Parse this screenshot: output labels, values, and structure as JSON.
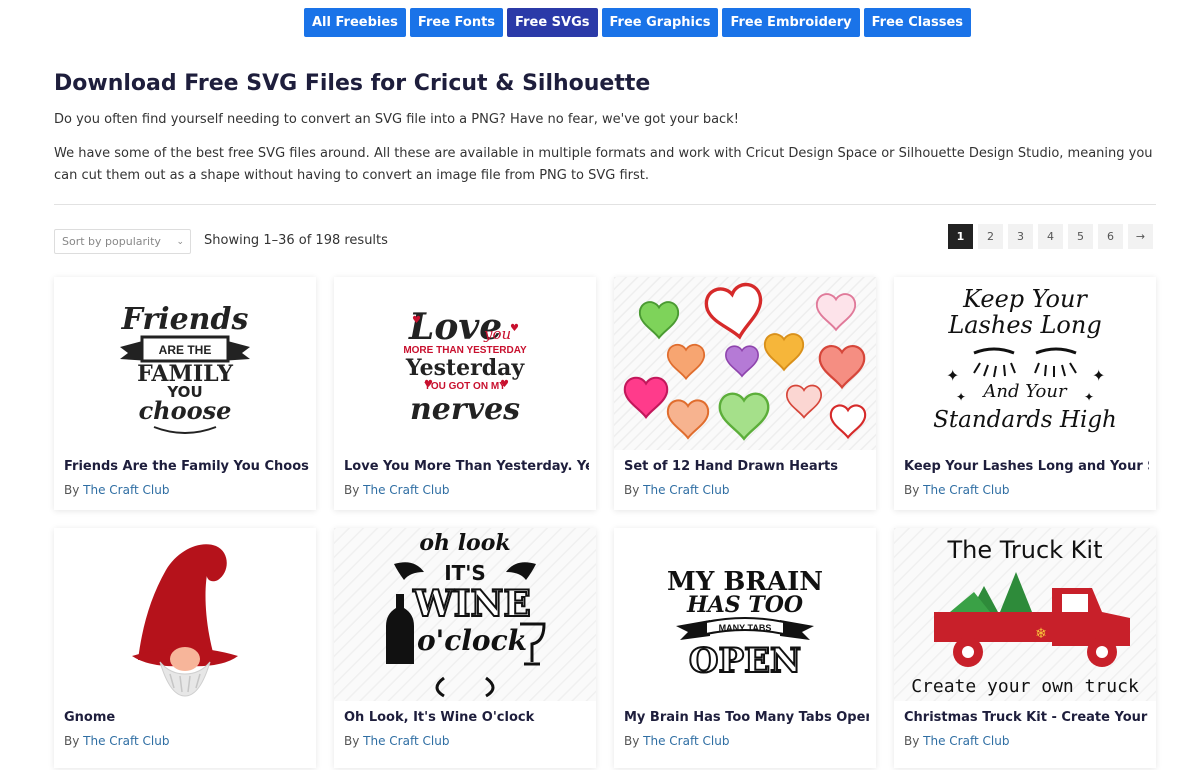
{
  "nav": {
    "tabs": [
      {
        "label": "All Freebies"
      },
      {
        "label": "Free Fonts"
      },
      {
        "label": "Free SVGs",
        "active": true
      },
      {
        "label": "Free Graphics"
      },
      {
        "label": "Free Embroidery"
      },
      {
        "label": "Free Classes"
      }
    ]
  },
  "header": {
    "title": "Download Free SVG Files for Cricut & Silhouette",
    "intro_1": "Do you often find yourself needing to convert an SVG file into a PNG? Have no fear, we've got your back!",
    "intro_2": "We have some of the best free SVG files around. All these are available in multiple formats and work with Cricut Design Space or Silhouette Design Studio, meaning you can cut them out as a shape without having to convert an image file from PNG to SVG first."
  },
  "toolbar": {
    "sort_label": "Sort by popularity",
    "results_text": "Showing 1–36 of 198 results"
  },
  "pagination": {
    "pages": [
      "1",
      "2",
      "3",
      "4",
      "5",
      "6",
      "→"
    ],
    "current": "1"
  },
  "by_prefix": "By",
  "products": [
    {
      "title": "Friends Are the Family You Choose",
      "author": "The Craft Club",
      "art": {
        "l1": "Friends",
        "l2": "ARE THE",
        "l3": "FAMILY",
        "l4": "YOU",
        "l5": "choose"
      }
    },
    {
      "title": "Love You More Than Yesterday. Yes",
      "author": "The Craft Club",
      "art": {
        "l1": "Love",
        "l2": "you",
        "l3": "MORE THAN YESTERDAY",
        "l4": "Yesterday",
        "l5": "YOU GOT ON MY",
        "l6": "nerves"
      }
    },
    {
      "title": "Set of 12 Hand Drawn Hearts",
      "author": "The Craft Club",
      "art": {}
    },
    {
      "title": "Keep Your Lashes Long and Your St",
      "author": "The Craft Club",
      "art": {
        "l1": "Keep Your",
        "l2": "Lashes Long",
        "l3": "And Your",
        "l4": "Standards High"
      }
    },
    {
      "title": "Gnome",
      "author": "The Craft Club",
      "art": {}
    },
    {
      "title": "Oh Look, It's Wine O'clock",
      "author": "The Craft Club",
      "art": {
        "l1": "oh look",
        "l2": "IT'S",
        "l3": "WINE",
        "l4": "o'clock"
      }
    },
    {
      "title": "My Brain Has Too Many Tabs Open",
      "author": "The Craft Club",
      "art": {
        "l1": "MY BRAIN",
        "l2": "HAS TOO",
        "l3": "MANY TABS",
        "l4": "OPEN"
      }
    },
    {
      "title": "Christmas Truck Kit - Create Your C",
      "author": "The Craft Club",
      "art": {
        "l1": "The Truck Kit",
        "l2": "Create your own truck"
      }
    }
  ],
  "colors": {
    "nav_tab": "#1a73e8",
    "nav_tab_active": "#2b3aa8",
    "title": "#1e1e3c",
    "author_link": "#2f6ea3",
    "valentine_red": "#c8102e",
    "gnome_hat": "#b5121b",
    "truck_red": "#c8202a",
    "tree_green": "#2e8b3a"
  }
}
